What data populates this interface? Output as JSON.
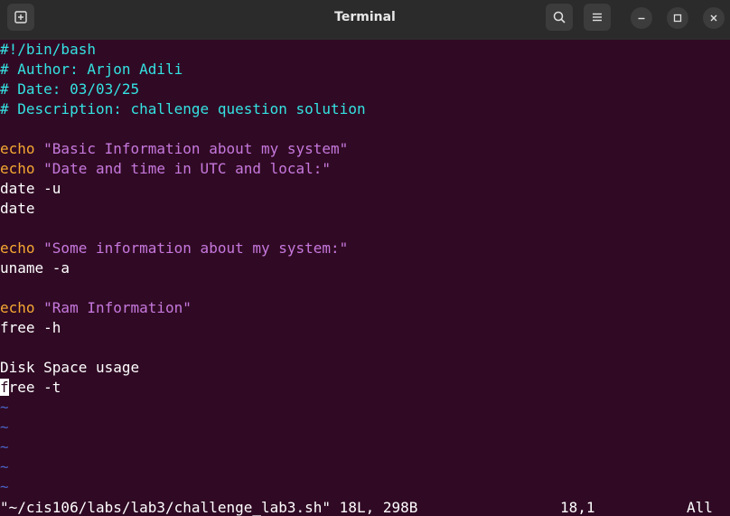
{
  "window": {
    "title": "Terminal",
    "icons": {
      "new_tab": "new-tab-icon",
      "search": "search-icon",
      "menu": "hamburger-menu-icon",
      "minimize": "minimize-icon",
      "maximize": "maximize-icon",
      "close": "close-icon"
    }
  },
  "editor": {
    "lines": {
      "l1": "#!/bin/bash",
      "l2": "# Author: Arjon Adili",
      "l3": "# Date: 03/03/25",
      "l4": "# Description: challenge question solution",
      "l6_cmd": "echo",
      "l6_str": " \"Basic Information about my system\"",
      "l7_cmd": "echo",
      "l7_str": " \"Date and time in UTC and local:\"",
      "l8": "date -u",
      "l9": "date",
      "l11_cmd": "echo",
      "l11_str": " \"Some information about my system:\"",
      "l12": "uname -a",
      "l14_cmd": "echo",
      "l14_str": " \"Ram Information\"",
      "l15": "free -h",
      "l17": "Disk Space usage",
      "l18_cursor_char": "f",
      "l18_rest": "ree -t"
    },
    "empty_marker": "~"
  },
  "status_bar": {
    "file_info": "\"~/cis106/labs/lab3/challenge_lab3.sh\" 18L, 298B",
    "position": "18,1",
    "scroll": "All"
  },
  "colors": {
    "background": "#300a24",
    "comment": "#34e2e2",
    "keyword": "#f6a832",
    "string": "#c678dd",
    "tilde": "#4a63c7"
  }
}
